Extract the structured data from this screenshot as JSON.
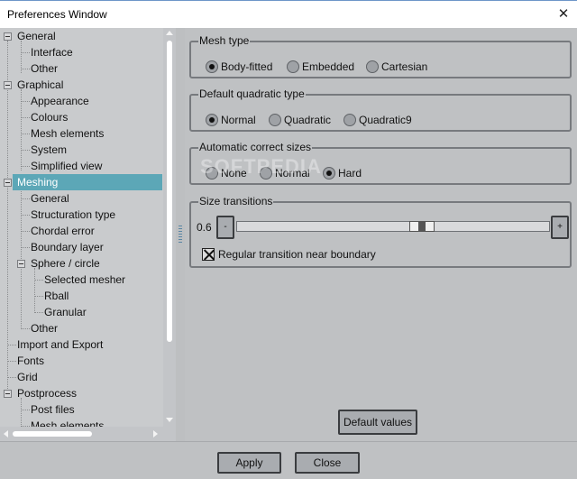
{
  "window": {
    "title": "Preferences Window",
    "close_glyph": "✕"
  },
  "tree": {
    "items": [
      {
        "label": "General"
      },
      {
        "label": "Interface"
      },
      {
        "label": "Other"
      },
      {
        "label": "Graphical"
      },
      {
        "label": "Appearance"
      },
      {
        "label": "Colours"
      },
      {
        "label": "Mesh elements"
      },
      {
        "label": "System"
      },
      {
        "label": "Simplified view"
      },
      {
        "label": "Meshing"
      },
      {
        "label": "General"
      },
      {
        "label": "Structuration type"
      },
      {
        "label": "Chordal error"
      },
      {
        "label": "Boundary layer"
      },
      {
        "label": "Sphere / circle"
      },
      {
        "label": "Selected mesher"
      },
      {
        "label": "Rball"
      },
      {
        "label": "Granular"
      },
      {
        "label": "Other"
      },
      {
        "label": "Import and Export"
      },
      {
        "label": "Fonts"
      },
      {
        "label": "Grid"
      },
      {
        "label": "Postprocess"
      },
      {
        "label": "Post files"
      },
      {
        "label": "Mesh elements"
      }
    ],
    "selected": "Meshing"
  },
  "mesh_type": {
    "label": "Mesh type",
    "options": [
      "Body-fitted",
      "Embedded",
      "Cartesian"
    ],
    "selected": "Body-fitted"
  },
  "quadratic": {
    "label": "Default quadratic type",
    "options": [
      "Normal",
      "Quadratic",
      "Quadratic9"
    ],
    "selected": "Normal"
  },
  "correct_sizes": {
    "label": "Automatic correct sizes",
    "options": [
      "None",
      "Normal",
      "Hard"
    ],
    "selected": "Hard"
  },
  "transitions": {
    "label": "Size transitions",
    "value": "0.6",
    "minus_label": "-",
    "plus_label": "+",
    "slider_fraction": 0.6,
    "checkbox_label": "Regular transition near boundary",
    "checkbox_checked": true
  },
  "buttons": {
    "default_values": "Default values",
    "apply": "Apply",
    "close": "Close"
  },
  "watermark": "SOFTPEDIA"
}
